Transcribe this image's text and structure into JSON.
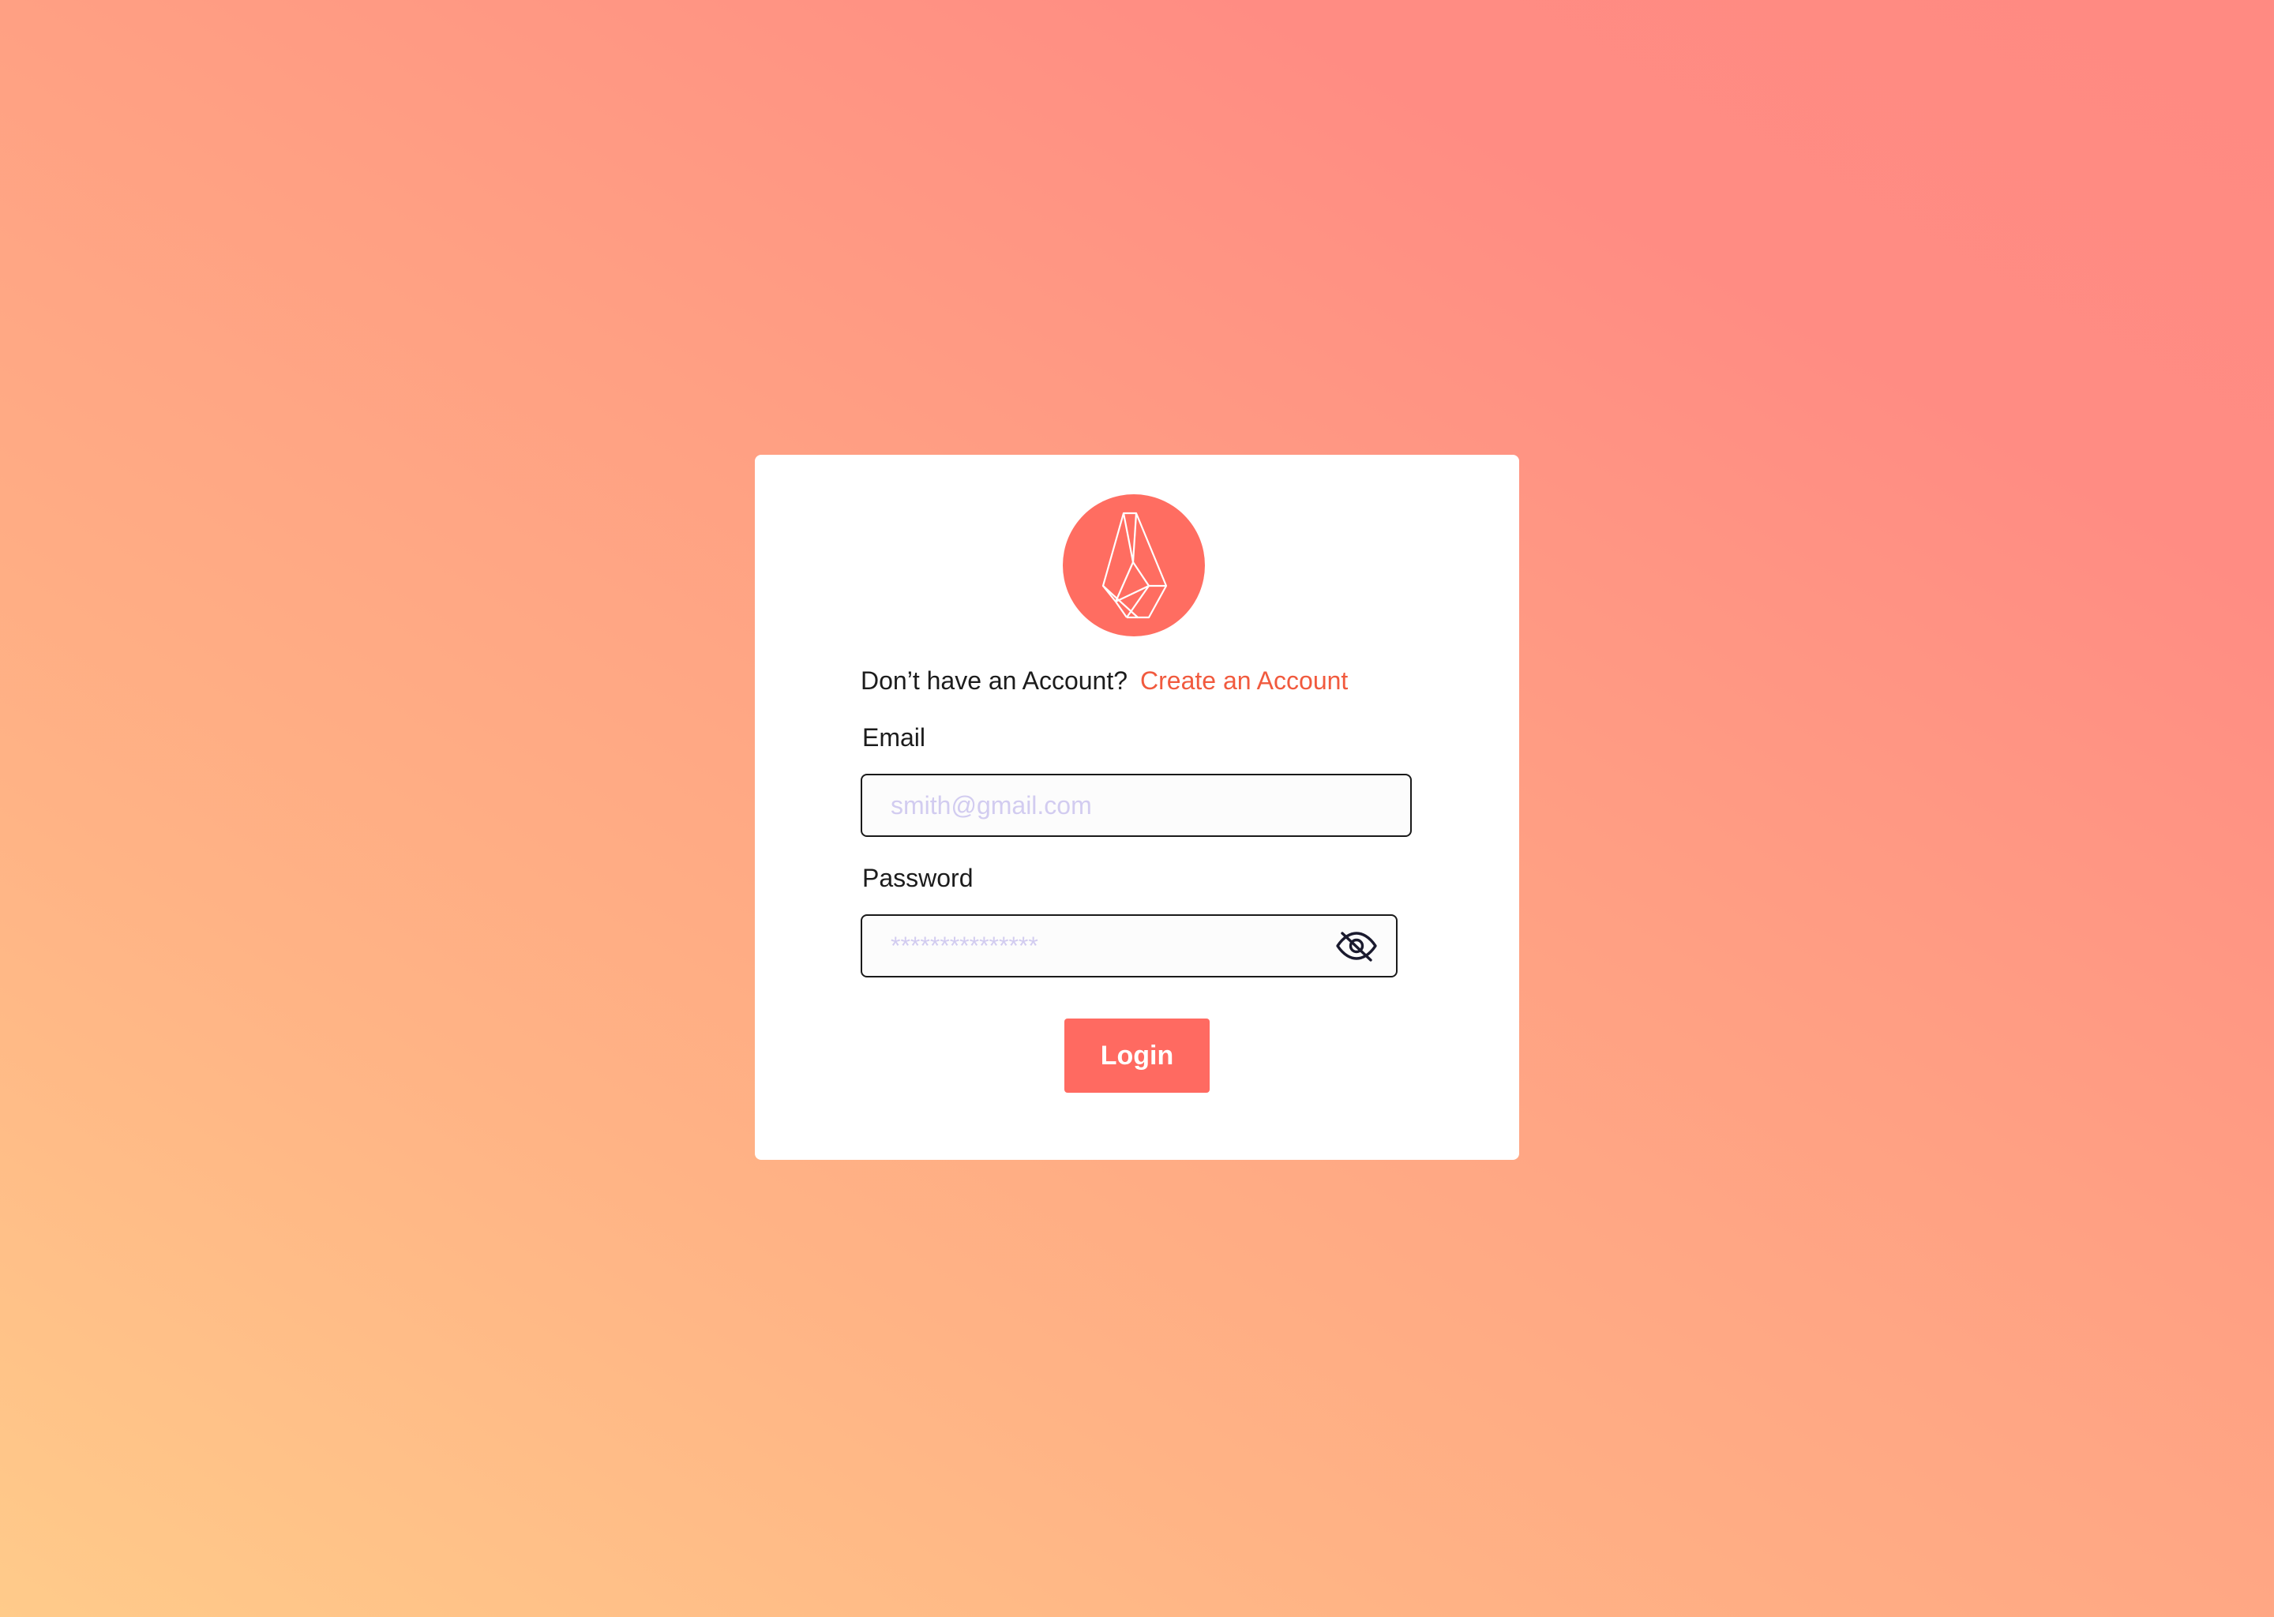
{
  "colors": {
    "background_start": "#FFCB8A",
    "background_end": "#FF8A82",
    "accent": "#FF6D61",
    "link": "#F15A3E",
    "placeholder": "#D2CCF0"
  },
  "logo": {
    "icon": "gem-crystal-logo-icon"
  },
  "signup": {
    "prompt": "Don’t have an Account?",
    "link_label": "Create an Account"
  },
  "email": {
    "label": "Email",
    "placeholder": "smith@gmail.com",
    "value": ""
  },
  "password": {
    "label": "Password",
    "placeholder": "***************",
    "value": "",
    "toggle_icon": "eye-slash-icon"
  },
  "login": {
    "label": "Login"
  }
}
